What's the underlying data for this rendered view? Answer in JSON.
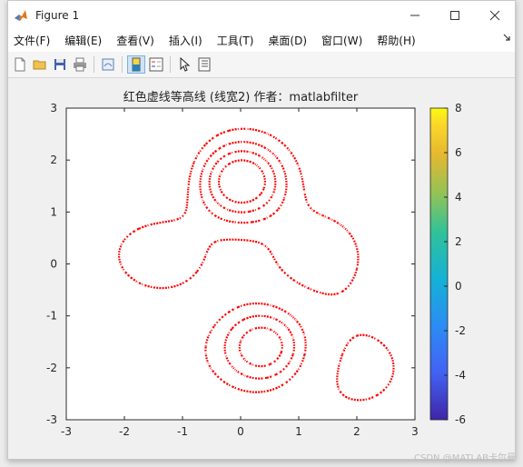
{
  "window": {
    "title": "Figure 1",
    "controls": [
      "minimize",
      "maximize",
      "close"
    ]
  },
  "menu": {
    "items": [
      "文件(F)",
      "编辑(E)",
      "查看(V)",
      "插入(I)",
      "工具(T)",
      "桌面(D)",
      "窗口(W)",
      "帮助(H)"
    ]
  },
  "toolbar": {
    "buttons": [
      "new-figure-icon",
      "open-folder-icon",
      "save-icon",
      "print-icon",
      "link-figure-icon",
      "colorbar-toggle-icon",
      "legend-toggle-icon",
      "edit-plot-arrow-icon",
      "property-inspector-icon"
    ]
  },
  "chart_data": {
    "type": "contour",
    "title": "红色虚线等高线 (线宽2) 作者：matlabfilter",
    "xlim": [
      -3,
      3
    ],
    "ylim": [
      -3,
      3
    ],
    "xticks": [
      "-3",
      "-2",
      "-1",
      "0",
      "1",
      "2",
      "3"
    ],
    "yticks": [
      "3",
      "2",
      "1",
      "0",
      "-1",
      "-2",
      "-3"
    ],
    "line_color": "#ff0000",
    "line_style": "dashed",
    "colorbar": {
      "min": -6,
      "max": 8,
      "ticks": [
        "8",
        "6",
        "4",
        "2",
        "0",
        "-2",
        "-4",
        "-6"
      ],
      "colormap": "parula"
    }
  },
  "footer": {
    "watermark": "CSDN @MATLAB卡尔曼"
  }
}
